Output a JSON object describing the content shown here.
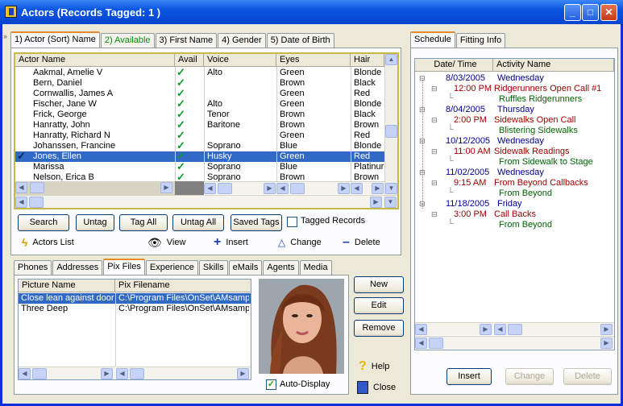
{
  "window": {
    "title": "Actors  (Records Tagged:  1 )"
  },
  "left_tabs": [
    {
      "label": "1) Actor (Sort) Name",
      "selected": true
    },
    {
      "label": "2) Available"
    },
    {
      "label": "3) First Name"
    },
    {
      "label": "4) Gender"
    },
    {
      "label": "5) Date of Birth"
    }
  ],
  "actors_grid": {
    "columns": [
      "Actor Name",
      "Avail",
      "Voice",
      "Eyes",
      "Hair"
    ],
    "rows": [
      {
        "name": "Aakmal, Amelie V",
        "voice": "Alto",
        "eyes": "Green",
        "hair": "Blonde"
      },
      {
        "name": "Bern, Daniel",
        "voice": "",
        "eyes": "Brown",
        "hair": "Black"
      },
      {
        "name": "Cornwallis, James A",
        "voice": "",
        "eyes": "Green",
        "hair": "Red"
      },
      {
        "name": "Fischer, Jane W",
        "voice": "Alto",
        "eyes": "Green",
        "hair": "Blonde"
      },
      {
        "name": "Frick, George",
        "voice": "Tenor",
        "eyes": "Brown",
        "hair": "Black"
      },
      {
        "name": "Hanratty, John",
        "voice": "Baritone",
        "eyes": "Brown",
        "hair": "Brown"
      },
      {
        "name": "Hanratty, Richard N",
        "voice": "",
        "eyes": "Green",
        "hair": "Red"
      },
      {
        "name": "Johanssen, Francine",
        "voice": "Soprano",
        "eyes": "Blue",
        "hair": "Blonde"
      },
      {
        "name": "Jones, Ellen",
        "voice": "Husky",
        "eyes": "Green",
        "hair": "Red"
      },
      {
        "name": "Marissa",
        "voice": "Soprano",
        "eyes": "Blue",
        "hair": "Platinur"
      },
      {
        "name": "Nelson, Erica B",
        "voice": "Soprano",
        "eyes": "Brown",
        "hair": "Brown"
      }
    ]
  },
  "actions": {
    "search": "Search",
    "untag": "Untag",
    "tag_all": "Tag All",
    "untag_all": "Untag All",
    "saved_tags": "Saved Tags",
    "tagged_records": "Tagged Records"
  },
  "toolbar": {
    "actors_list": "Actors List",
    "view": "View",
    "insert": "Insert",
    "change": "Change",
    "delete": "Delete"
  },
  "bottom_tabs": [
    {
      "label": "Phones"
    },
    {
      "label": "Addresses"
    },
    {
      "label": "Pix Files",
      "selected": true
    },
    {
      "label": "Experience"
    },
    {
      "label": "Skills"
    },
    {
      "label": "eMails"
    },
    {
      "label": "Agents"
    },
    {
      "label": "Media"
    }
  ],
  "pix_grid": {
    "columns": [
      "Picture Name",
      "Pix Filename"
    ],
    "rows": [
      {
        "name": "Close lean against door",
        "file": "C:\\Program Files\\OnSet\\AMsamp\\"
      },
      {
        "name": "Three Deep",
        "file": "C:\\Program Files\\OnSet\\AMsamp\\"
      }
    ]
  },
  "pix_buttons": {
    "new": "New",
    "edit": "Edit",
    "remove": "Remove",
    "auto_display": "Auto-Display",
    "help": "Help",
    "close": "Close"
  },
  "right_tabs": [
    {
      "label": "Schedule",
      "selected": true
    },
    {
      "label": "Fitting Info"
    }
  ],
  "schedule": {
    "columns": [
      "Date/ Time",
      "Activity Name"
    ],
    "days": [
      {
        "date": "8/03/2005",
        "dow": "Wednesday",
        "time": "12:00 PM",
        "activity": "Ridgerunners Open Call #1",
        "place": "Ruffles Ridgerunners"
      },
      {
        "date": "8/04/2005",
        "dow": "Thursday",
        "time": "2:00 PM",
        "activity": "Sidewalks Open Call",
        "place": "Blistering Sidewalks"
      },
      {
        "date": "10/12/2005",
        "dow": "Wednesday",
        "time": "11:00 AM",
        "activity": "Sidewalk Readings",
        "place": "From Sidewalk to Stage"
      },
      {
        "date": "11/02/2005",
        "dow": "Wednesday",
        "time": "9:15 AM",
        "activity": "From Beyond Callbacks",
        "place": "From Beyond"
      },
      {
        "date": "11/18/2005",
        "dow": "Friday",
        "time": "3:00 PM",
        "activity": "Call Backs",
        "place": "From Beyond"
      }
    ],
    "buttons": {
      "insert": "Insert",
      "change": "Change",
      "delete": "Delete"
    }
  },
  "colors": {
    "date_blue": "#00008b",
    "time_red": "#a00000",
    "place_green": "#006400",
    "selection": "#316ac5"
  }
}
